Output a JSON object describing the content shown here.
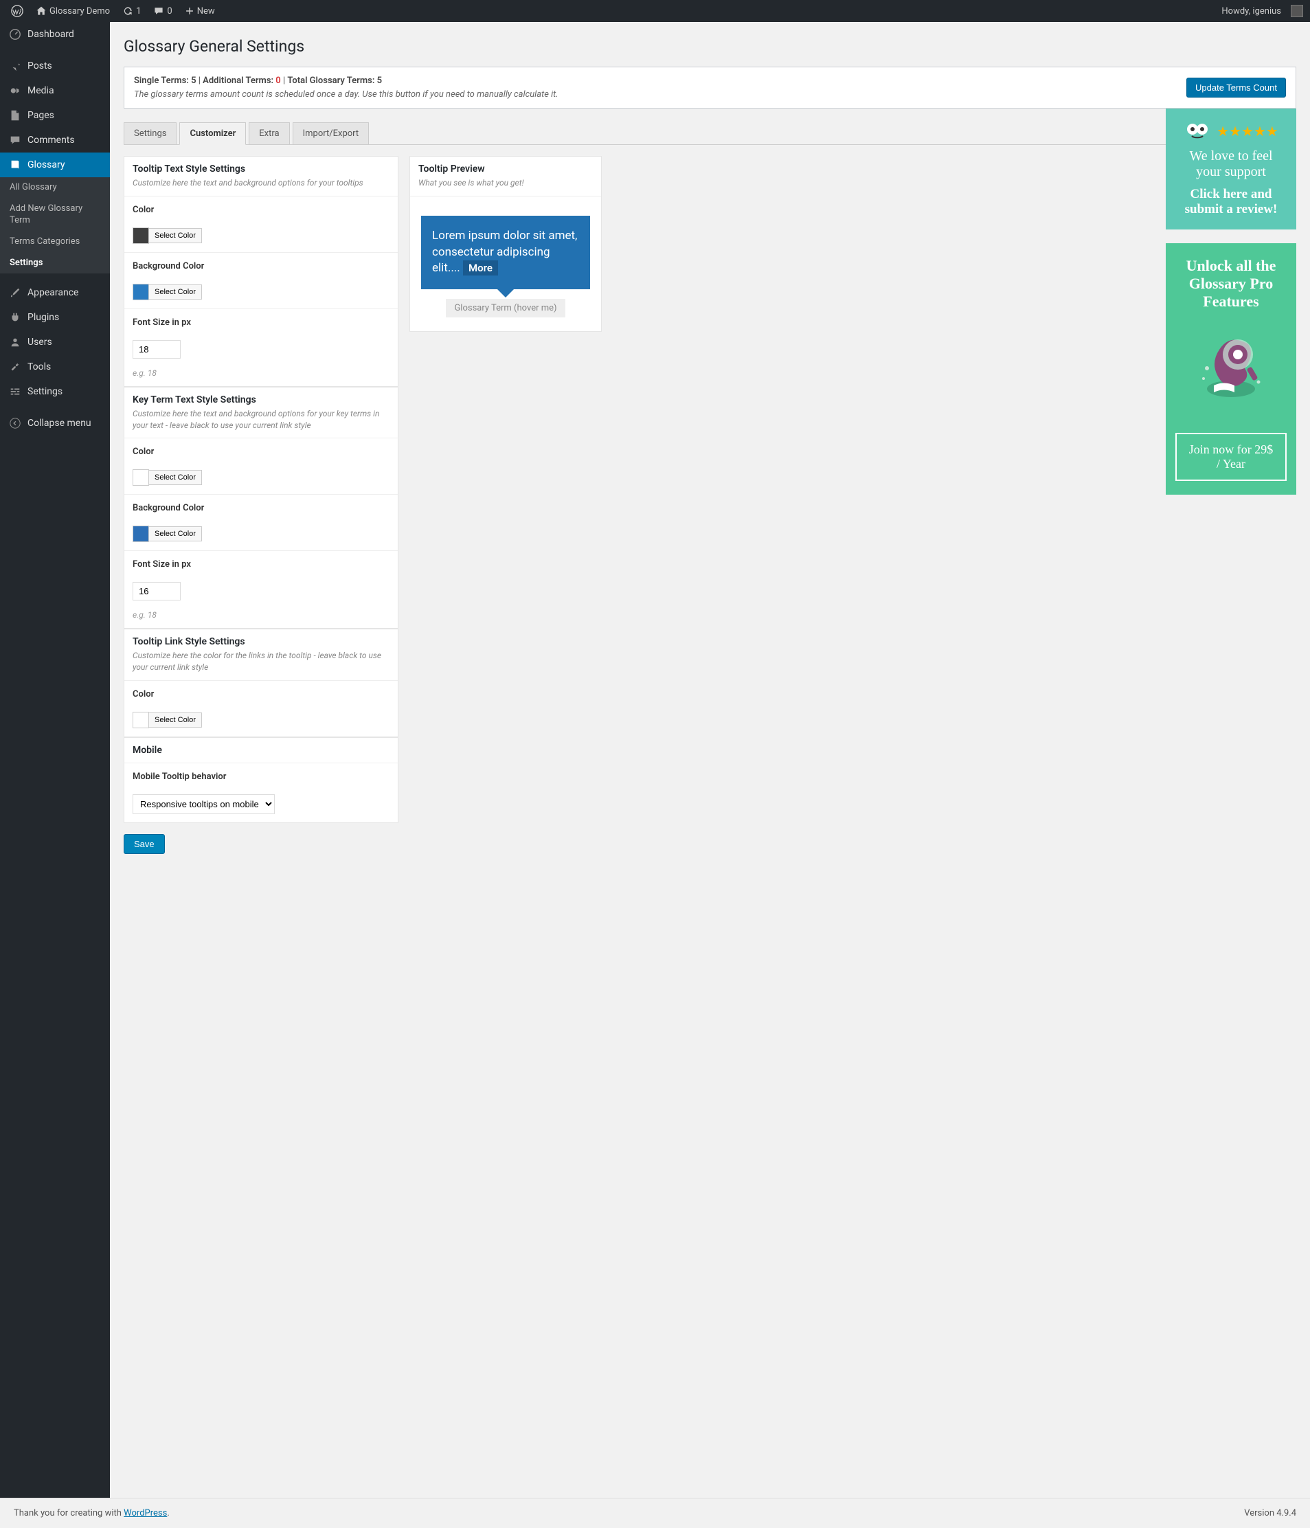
{
  "topbar": {
    "site_name": "Glossary Demo",
    "updates": "1",
    "comments": "0",
    "new": "New",
    "howdy": "Howdy, igenius"
  },
  "sidebar": {
    "dashboard": "Dashboard",
    "posts": "Posts",
    "media": "Media",
    "pages": "Pages",
    "comments": "Comments",
    "glossary": "Glossary",
    "sub_all": "All Glossary",
    "sub_add": "Add New Glossary Term",
    "sub_cats": "Terms Categories",
    "sub_settings": "Settings",
    "appearance": "Appearance",
    "plugins": "Plugins",
    "users": "Users",
    "tools": "Tools",
    "settings": "Settings",
    "collapse": "Collapse menu"
  },
  "page": {
    "title": "Glossary General Settings"
  },
  "notice": {
    "single_label": "Single Terms:",
    "single_value": "5",
    "additional_label": "Additional Terms:",
    "additional_value": "0",
    "total_label": "Total Glossary Terms:",
    "total_value": "5",
    "desc": "The glossary terms amount count is scheduled once a day. Use this button if you need to manually calculate it.",
    "button": "Update Terms Count"
  },
  "tabs": {
    "settings": "Settings",
    "customizer": "Customizer",
    "extra": "Extra",
    "import": "Import/Export"
  },
  "section1": {
    "title": "Tooltip Text Style Settings",
    "sub": "Customize here the text and background options for your tooltips",
    "color_label": "Color",
    "bg_label": "Background Color",
    "font_label": "Font Size in px",
    "font_value": "18",
    "hint": "e.g. 18",
    "select_color": "Select Color",
    "color_swatch": "#3f3f3f",
    "bg_swatch": "#2a7bc0"
  },
  "section2": {
    "title": "Key Term Text Style Settings",
    "sub": "Customize here the text and background options for your key terms in your text - leave black to use your current link style",
    "color_label": "Color",
    "bg_label": "Background Color",
    "font_label": "Font Size in px",
    "font_value": "16",
    "hint": "e.g. 18",
    "select_color": "Select Color",
    "color_swatch": "#ffffff",
    "bg_swatch": "#2d6fb6"
  },
  "section3": {
    "title": "Tooltip Link Style Settings",
    "sub": "Customize here the color for the links in the tooltip - leave black to use your current link style",
    "color_label": "Color",
    "select_color": "Select Color",
    "color_swatch": "#ffffff"
  },
  "section4": {
    "title": "Mobile",
    "behavior_label": "Mobile Tooltip behavior",
    "behavior_value": "Responsive tooltips on mobile"
  },
  "preview": {
    "title": "Tooltip Preview",
    "sub": "What you see is what you get!",
    "lorem": "Lorem ipsum dolor sit amet, consectetur adipiscing elit....",
    "more": "More",
    "term": "Glossary Term (hover me)"
  },
  "save": "Save",
  "promo1": {
    "love": "We love to feel your support",
    "click": "Click here and submit a review!"
  },
  "promo2": {
    "title": "Unlock all the Glossary Pro Features",
    "join": "Join now for 29$ / Year"
  },
  "footer": {
    "thank": "Thank you for creating with ",
    "wp": "WordPress",
    "version": "Version 4.9.4"
  }
}
